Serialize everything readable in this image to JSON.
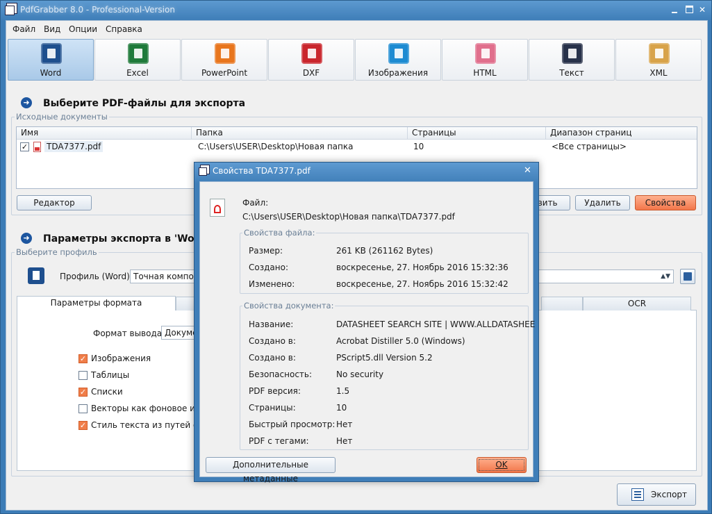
{
  "window": {
    "title": "PdfGrabber 8.0 - Professional-Version"
  },
  "menu": [
    "Файл",
    "Вид",
    "Опции",
    "Справка"
  ],
  "formats": [
    {
      "label": "Word",
      "color": "#1e4f8e",
      "active": true
    },
    {
      "label": "Excel",
      "color": "#1f7a3a"
    },
    {
      "label": "PowerPoint",
      "color": "#e8761e"
    },
    {
      "label": "DXF",
      "color": "#c9262d"
    },
    {
      "label": "Изображения",
      "color": "#1d8bd2"
    },
    {
      "label": "HTML",
      "color": "#e06f8c"
    },
    {
      "label": "Текст",
      "color": "#28324a"
    },
    {
      "label": "XML",
      "color": "#d8a34a"
    }
  ],
  "select_section": {
    "title": "Выберите PDF-файлы для экспорта",
    "group_label": "Исходные документы",
    "columns": [
      "Имя",
      "Папка",
      "Страницы",
      "Диапазон страниц"
    ],
    "rows": [
      {
        "name": "TDA7377.pdf",
        "folder": "C:\\Users\\USER\\Desktop\\Новая папка",
        "pages": "10",
        "range": "<Все страницы>"
      }
    ],
    "buttons": {
      "editor": "Редактор",
      "add": "авить",
      "delete": "Удалить",
      "properties": "Свойства"
    }
  },
  "export_section": {
    "title": "Параметры экспорта в 'Word'",
    "group_label": "Выберите профиль",
    "profile_label": "Профиль (Word):",
    "profile_value": "Точная компоно",
    "tabs": [
      "Параметры формата",
      "OCR"
    ],
    "output_format_label": "Формат вывода:",
    "output_format_value": "Докумен",
    "options": [
      {
        "label": "Изображения",
        "checked": true
      },
      {
        "label": "Таблицы",
        "checked": false
      },
      {
        "label": "Списки",
        "checked": true
      },
      {
        "label": "Векторы как фоновое изоб",
        "checked": false
      },
      {
        "label": "Стиль текста из путей обна",
        "checked": true
      }
    ],
    "export_button": "Экспорт"
  },
  "dialog": {
    "title": "Свойства TDA7377.pdf",
    "file_label": "Файл:",
    "file_path": "C:\\Users\\USER\\Desktop\\Новая папка\\TDA7377.pdf",
    "file_props_label": "Свойства файла:",
    "file_props": [
      {
        "label": "Размер:",
        "value": "261 KB (261162 Bytes)"
      },
      {
        "label": "Создано:",
        "value": "воскресенье, 27. Ноябрь 2016 15:32:36"
      },
      {
        "label": "Изменено:",
        "value": "воскресенье, 27. Ноябрь 2016 15:32:42"
      }
    ],
    "doc_props_label": "Свойства документа:",
    "doc_props": [
      {
        "label": "Название:",
        "value": "DATASHEET SEARCH SITE | WWW.ALLDATASHEE"
      },
      {
        "label": "Создано в:",
        "value": "Acrobat Distiller 5.0 (Windows)"
      },
      {
        "label": "Создано в:",
        "value": "PScript5.dll Version 5.2"
      },
      {
        "label": "Безопасность:",
        "value": "No security"
      },
      {
        "label": "PDF версия:",
        "value": "1.5"
      },
      {
        "label": "Страницы:",
        "value": "10"
      },
      {
        "label": "Быстрый просмотр:",
        "value": "Нет"
      },
      {
        "label": "PDF с тегами:",
        "value": "Нет"
      }
    ],
    "metadata_button": "Дополнительные метаданные",
    "ok_button": "OK"
  }
}
